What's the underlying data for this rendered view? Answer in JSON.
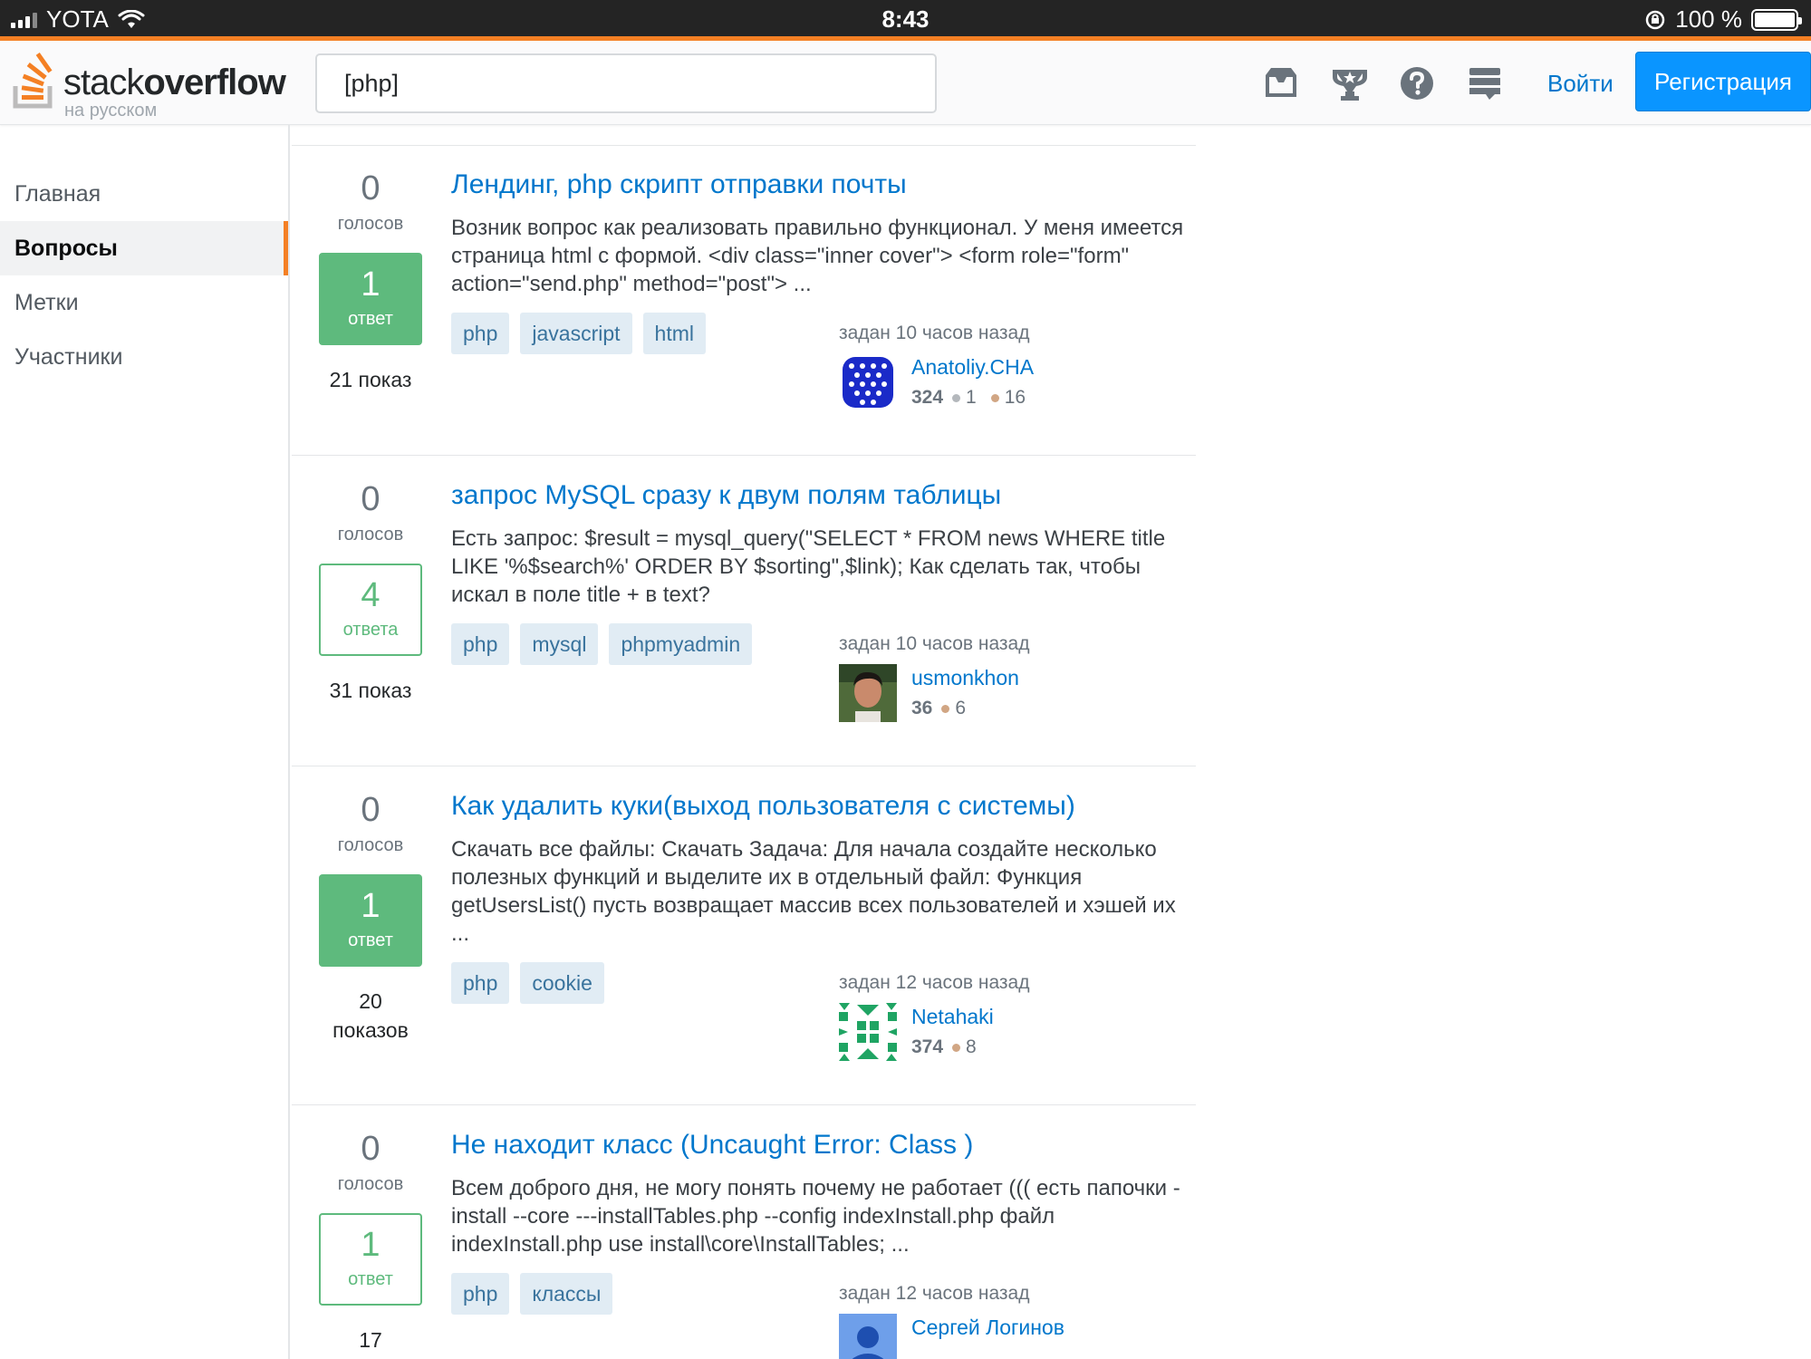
{
  "status_bar": {
    "carrier": "YOTA",
    "time": "8:43",
    "battery": "100 %",
    "battery_level": 1.0
  },
  "header": {
    "logo_main": "stack",
    "logo_bold": "overflow",
    "logo_sub": "на русском",
    "search_value": "[php]",
    "icons": [
      "inbox-icon",
      "trophy-icon",
      "help-icon",
      "stackexchange-icon"
    ],
    "login_label": "Войти",
    "signup_label": "Регистрация"
  },
  "nav": {
    "items": [
      {
        "label": "Главная"
      },
      {
        "label": "Вопросы"
      },
      {
        "label": "Метки"
      },
      {
        "label": "Участники"
      }
    ],
    "active_index": 1
  },
  "questions": [
    {
      "votes": "0",
      "votes_label": "голосов",
      "answers": "1",
      "answers_label": "ответ",
      "accepted": true,
      "views": "21 показ",
      "title": "Лендинг, php скрипт отправки почты",
      "excerpt": "Возник вопрос как реализовать правильно функционал. У меня имеется страница html с формой. <div class=\"inner cover\"> <form role=\"form\" action=\"send.php\" method=\"post\"> ...",
      "tags": [
        "php",
        "javascript",
        "html"
      ],
      "asked": "задан 10 часов назад",
      "user": {
        "name": "Anatoliy.CHA",
        "rep": "324",
        "silver": "1",
        "bronze": "16"
      }
    },
    {
      "votes": "0",
      "votes_label": "голосов",
      "answers": "4",
      "answers_label": "ответа",
      "accepted": false,
      "views": "31 показ",
      "title": "запрос MySQL сразу к двум полям таблицы",
      "excerpt": "Есть запрос: $result = mysql_query(\"SELECT * FROM news WHERE title LIKE '%$search%' ORDER BY $sorting\",$link); Как сделать так, чтобы искал в поле title + в text?",
      "tags": [
        "php",
        "mysql",
        "phpmyadmin"
      ],
      "asked": "задан 10 часов назад",
      "user": {
        "name": "usmonkhon",
        "rep": "36",
        "bronze": "6"
      }
    },
    {
      "votes": "0",
      "votes_label": "голосов",
      "answers": "1",
      "answers_label": "ответ",
      "accepted": true,
      "views": "20 показов",
      "title": "Как удалить куки(выход пользователя с системы)",
      "excerpt": "Скачать все файлы: Скачать Задача: Для начала создайте несколько полезных функций и выделите их в отдельный файл: Функция getUsersList() пусть возвращает массив всех пользователей и хэшей их ...",
      "tags": [
        "php",
        "cookie"
      ],
      "asked": "задан 12 часов назад",
      "user": {
        "name": "Netahaki",
        "rep": "374",
        "bronze": "8"
      }
    },
    {
      "votes": "0",
      "votes_label": "голосов",
      "answers": "1",
      "answers_label": "ответ",
      "accepted": false,
      "views": "17",
      "title": "Не находит класс (Uncaught Error: Class )",
      "excerpt": "Всем доброго дня, не могу понять почему не работает ((( есть папочки - install --core ---installTables.php --config indexInstall.php файл indexInstall.php use install\\core\\InstallTables; ...",
      "tags": [
        "php",
        "классы"
      ],
      "asked": "задан 12 часов назад",
      "user": {
        "name": "Сергей Логинов"
      }
    }
  ]
}
